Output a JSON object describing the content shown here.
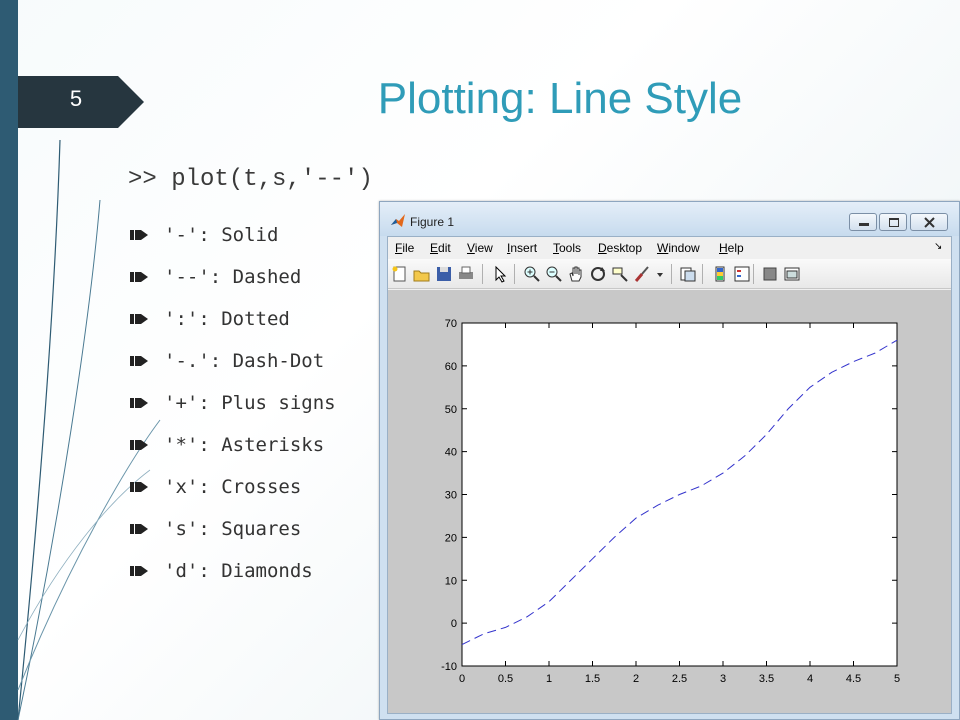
{
  "slide": {
    "number": "5",
    "title": "Plotting: Line Style",
    "command": ">> plot(t,s,'--')",
    "bullets": [
      {
        "text": "'-': Solid"
      },
      {
        "text": "'--': Dashed"
      },
      {
        "text": "':': Dotted"
      },
      {
        "text": "'-.': Dash-Dot"
      },
      {
        "text": "'+': Plus signs"
      },
      {
        "text": "'*': Asterisks"
      },
      {
        "text": "'x': Crosses"
      },
      {
        "text": "'s': Squares"
      },
      {
        "text": "'d': Diamonds"
      }
    ]
  },
  "figure": {
    "title": "Figure 1",
    "menu": [
      {
        "pre": "",
        "u": "F",
        "post": "ile"
      },
      {
        "pre": "",
        "u": "E",
        "post": "dit"
      },
      {
        "pre": "",
        "u": "V",
        "post": "iew"
      },
      {
        "pre": "",
        "u": "I",
        "post": "nsert"
      },
      {
        "pre": "",
        "u": "T",
        "post": "ools"
      },
      {
        "pre": "",
        "u": "D",
        "post": "esktop"
      },
      {
        "pre": "",
        "u": "W",
        "post": "indow"
      },
      {
        "pre": "",
        "u": "H",
        "post": "elp"
      }
    ],
    "menu_more": "↘",
    "toolbar_icons": [
      "new-figure-icon",
      "open-file-icon",
      "save-icon",
      "print-icon",
      "edit-plot-icon",
      "zoom-in-icon",
      "zoom-out-icon",
      "pan-icon",
      "rotate-3d-icon",
      "data-cursor-icon",
      "brush-icon",
      "brush-dropdown-icon",
      "link-plot-icon",
      "insert-colorbar-icon",
      "insert-legend-icon",
      "hide-plot-tools-icon",
      "show-plot-tools-icon"
    ],
    "line_color": "#3333cc"
  },
  "chart_data": {
    "type": "line",
    "title": "",
    "xlabel": "",
    "ylabel": "",
    "xlim": [
      0,
      5
    ],
    "ylim": [
      -10,
      70
    ],
    "xticks": [
      "0",
      "0.5",
      "1",
      "1.5",
      "2",
      "2.5",
      "3",
      "3.5",
      "4",
      "4.5",
      "5"
    ],
    "yticks": [
      "-10",
      "0",
      "10",
      "20",
      "30",
      "40",
      "50",
      "60",
      "70"
    ],
    "grid": false,
    "line_style": "dashed",
    "series": [
      {
        "x": [
          0,
          0.25,
          0.5,
          0.75,
          1,
          1.25,
          1.5,
          1.75,
          2,
          2.25,
          2.5,
          2.75,
          3,
          3.25,
          3.5,
          3.75,
          4,
          4.25,
          4.5,
          4.75,
          5
        ],
        "values": [
          -5,
          -2.5,
          -1,
          1.5,
          5,
          10,
          15,
          20,
          24.5,
          27.5,
          30,
          32,
          35,
          39,
          44,
          50,
          55,
          58.5,
          61,
          63,
          66
        ]
      }
    ]
  }
}
